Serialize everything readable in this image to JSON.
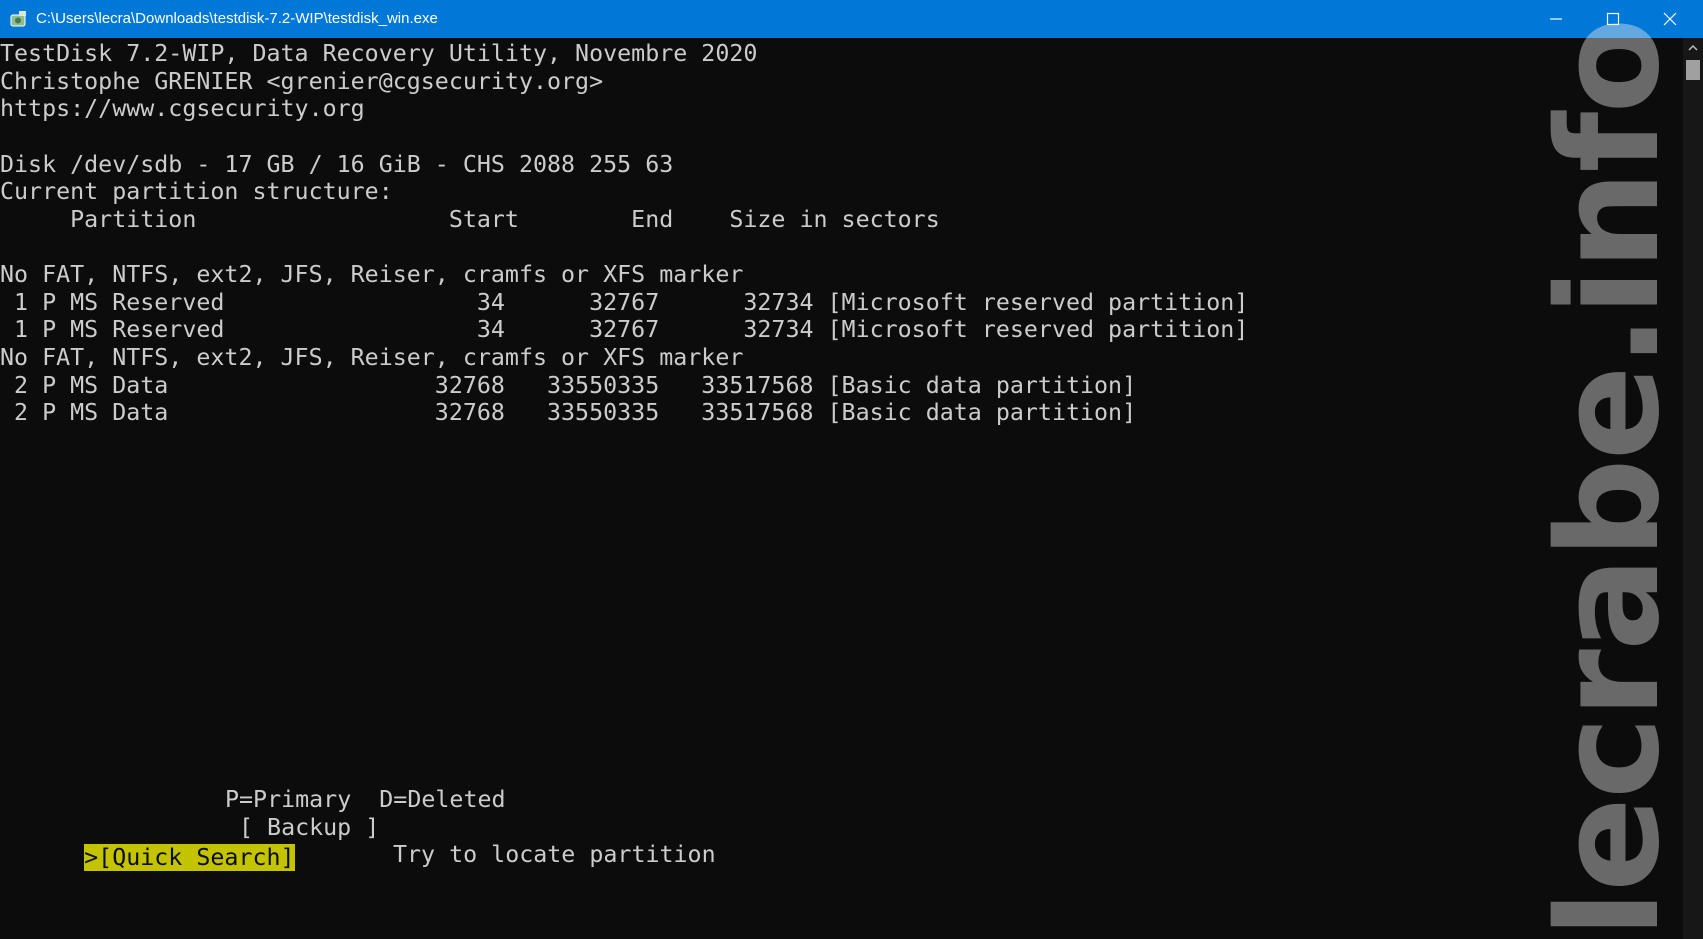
{
  "window": {
    "title": "C:\\Users\\lecra\\Downloads\\testdisk-7.2-WIP\\testdisk_win.exe"
  },
  "console": {
    "header": [
      "TestDisk 7.2-WIP, Data Recovery Utility, Novembre 2020",
      "Christophe GRENIER <grenier@cgsecurity.org>",
      "https://www.cgsecurity.org"
    ],
    "disk_info": "Disk /dev/sdb - 17 GB / 16 GiB - CHS 2088 255 63",
    "structure_heading": "Current partition structure:",
    "table_header": "     Partition                  Start        End    Size in sectors",
    "rows": [
      "No FAT, NTFS, ext2, JFS, Reiser, cramfs or XFS marker",
      " 1 P MS Reserved                  34      32767      32734 [Microsoft reserved partition]",
      " 1 P MS Reserved                  34      32767      32734 [Microsoft reserved partition]",
      "No FAT, NTFS, ext2, JFS, Reiser, cramfs or XFS marker",
      " 2 P MS Data                   32768   33550335   33517568 [Basic data partition]",
      " 2 P MS Data                   32768   33550335   33517568 [Basic data partition]"
    ],
    "legend": "P=Primary  D=Deleted",
    "menu": {
      "quick_search": ">[Quick Search]",
      "backup": "[ Backup ]"
    },
    "hint": "Try to locate partition"
  },
  "watermark": "lecrabe.info",
  "colors": {
    "titlebar": "#0078d7",
    "console_bg": "#0c0c0c",
    "console_text": "#cccccc",
    "selected_bg": "#c3c300"
  }
}
